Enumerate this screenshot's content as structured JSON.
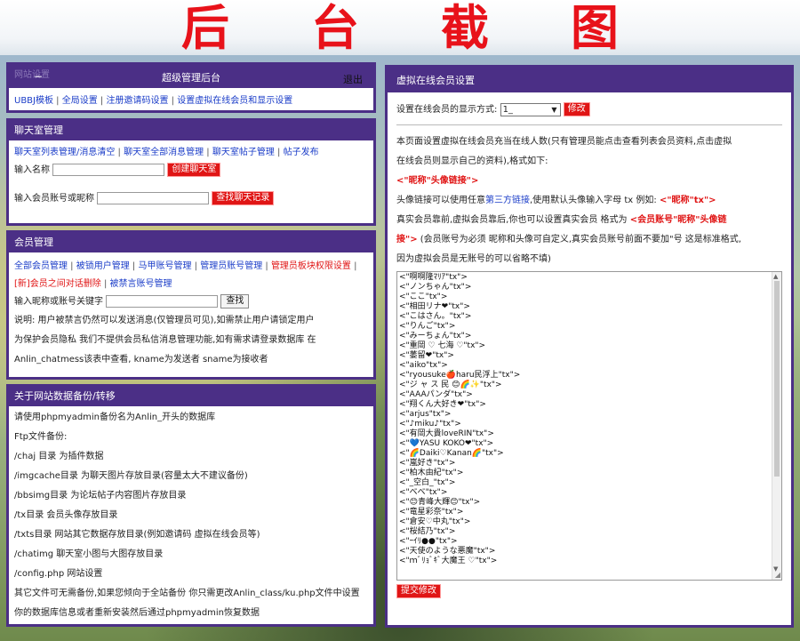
{
  "banner": {
    "title": "后台截图"
  },
  "admin_header": {
    "ghost_text": "网站设置",
    "dash": "−",
    "title": "超级管理后台",
    "logout": "退出"
  },
  "site_settings": {
    "links": [
      "UBBJ模板",
      "全局设置",
      "注册邀请码设置",
      "设置虚拟在线会员和显示设置"
    ]
  },
  "chatroom": {
    "heading": "聊天室管理",
    "links": [
      "聊天室列表管理/消息清空",
      "聊天室全部消息管理",
      "聊天室帖子管理",
      "帖子发布"
    ],
    "name_label": "输入名称",
    "create_button": "创建聊天室",
    "member_label": "输入会员账号或昵称",
    "find_button": "查找聊天记录"
  },
  "members": {
    "heading": "会员管理",
    "links_row1": [
      "全部会员管理",
      "被锁用户管理",
      "马甲账号管理",
      "管理员账号管理"
    ],
    "links_row1_red": "管理员板块权限设置",
    "links_row2_red": "[新]会员之间对话删除",
    "links_row2": "被禁言账号管理",
    "search_label": "输入昵称或账号关键字",
    "search_button": "查找",
    "notes": [
      "说明: 用户被禁言仍然可以发送消息(仅管理员可见),如需禁止用户请锁定用户",
      "为保护会员隐私 我们不提供会员私信消息管理功能,如有需求请登录数据库 在",
      "Anlin_chatmess该表中查看, kname为发送者 sname为接收者"
    ]
  },
  "backup": {
    "heading": "关于网站数据备份/转移",
    "lines": [
      "请使用phpmyadmin备份名为Anlin_开头的数据库",
      "Ftp文件备份:",
      "/chaj 目录 为插件数据",
      "/imgcache目录 为聊天图片存放目录(容量太大不建议备份)",
      "/bbsimg目录 为论坛帖子内容图片存放目录",
      "/tx目录 会员头像存放目录",
      "/txts目录 网站其它数据存放目录(例如邀请码 虚拟在线会员等)",
      "/chatimg 聊天室小图与大图存放目录",
      "/config.php 网站设置",
      "其它文件可无需备份,如果您倾向于全站备份 你只需更改Anlin_class/ku.php文件中设置",
      "你的数据库信息或者重新安装然后通过phpmyadmin恢复数据"
    ]
  },
  "virtual": {
    "heading": "虚拟在线会员设置",
    "display_label": "设置在线会员的显示方式:",
    "display_value": "1_",
    "modify_button": "修改",
    "desc_line1": "本页面设置虚拟在线会员充当在线人数(只有管理员能点击查看列表会员资料,点击虚拟",
    "desc_line2": "在线会员则显示自己的资料),格式如下:",
    "format_example": "<\"昵称\"头像链接\">",
    "avatar_text_a": "头像链接可以使用任意",
    "avatar_link": "第三方链接",
    "avatar_text_b": ",使用默认头像输入字母 tx 例如: ",
    "avatar_example": "<\"昵称\"tx\">",
    "real_line1_a": "真实会员靠前,虚拟会员靠后,你也可以设置真实会员 格式为 ",
    "real_line1_b": "<会员账号\"昵称\"头像链",
    "real_line2_a": "接\">",
    "real_line2_b": " (会员账号为必须 昵称和头像可自定义,真实会员账号前面不要加\"号 这是标准格式,",
    "real_line3": "因为虚拟会员是无账号的可以省略不填)",
    "list": [
      "<\"啊啊隆ﾏﾘｱ\"tx\">",
      "<\"ノンちゃん\"tx\">",
      "<\"ここ\"tx\">",
      "<\"相田リナ❤\"tx\">",
      "<\"こはさん。\"tx\">",
      "<\"りんご\"tx\">",
      "<\"みーちょん\"tx\">",
      "<\"重岡 ♡ 七海 ♡\"tx\">",
      "<\"萎留❤\"tx\">",
      "<\"aiko\"tx\">",
      "<\"ryousuke🍎haru民浮上\"tx\">",
      "<\"ジ ャ ス 民 😊🌈✨\"tx\">",
      "<\"AAAパンダ\"tx\">",
      "<\"翔くん大好き❤\"tx\">",
      "<\"arjus\"tx\">",
      "<\"♪miku♪\"tx\">",
      "<\"有岡大貴loveRIN\"tx\">",
      "<\"💙YASU KOKO❤\"tx\">",
      "<\"🌈Daiki♡Kanan🌈\"tx\">",
      "<\"嵐好き\"tx\">",
      "<\"柏木由紀\"tx\">",
      "<\"_空白_\"tx\">",
      "<\"べべ\"tx\">",
      "<\"😊青峰大輝😊\"tx\">",
      "<\"竜星彩奈\"tx\">",
      "<\"倉安♡中丸\"tx\">",
      "<\"桜結乃\"tx\">",
      "<\"ｰｲﾘ●●\"tx\">",
      "<\"天使のような悪魔\"tx\">",
      "<\"ｍﾞﾘｮﾞｷﾞ大魔王 ♡\"tx\">"
    ],
    "submit_button": "提交修改"
  }
}
